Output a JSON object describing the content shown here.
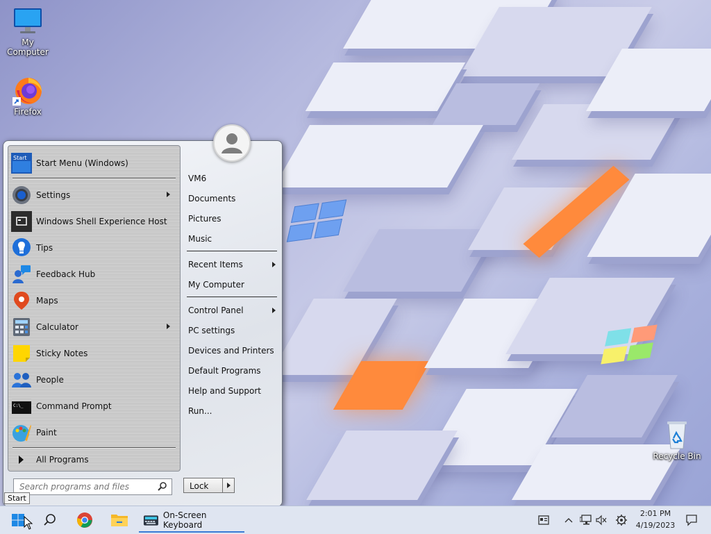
{
  "desktop": {
    "icons": [
      {
        "label": "My Computer",
        "icon": "monitor-icon"
      },
      {
        "label": "Firefox",
        "icon": "firefox-icon"
      },
      {
        "label": "Recycle Bin",
        "icon": "recycle-bin-icon"
      }
    ]
  },
  "start_menu": {
    "pinned": [
      {
        "label": "Start Menu (Windows)",
        "icon": "start-menu-icon",
        "has_submenu": false
      },
      {
        "label": "Settings",
        "icon": "gear-icon",
        "has_submenu": true
      },
      {
        "label": "Windows Shell Experience Host",
        "icon": "shell-host-icon",
        "has_submenu": false
      },
      {
        "label": "Tips",
        "icon": "lightbulb-icon",
        "has_submenu": false
      },
      {
        "label": "Feedback Hub",
        "icon": "feedback-icon",
        "has_submenu": false
      },
      {
        "label": "Maps",
        "icon": "map-pin-icon",
        "has_submenu": false
      },
      {
        "label": "Calculator",
        "icon": "calculator-icon",
        "has_submenu": true
      },
      {
        "label": "Sticky Notes",
        "icon": "sticky-note-icon",
        "has_submenu": false
      },
      {
        "label": "People",
        "icon": "people-icon",
        "has_submenu": false
      },
      {
        "label": "Command Prompt",
        "icon": "terminal-icon",
        "has_submenu": false
      },
      {
        "label": "Paint",
        "icon": "paint-icon",
        "has_submenu": false
      }
    ],
    "all_programs": "All Programs",
    "right_items": [
      {
        "label": "VM6",
        "has_submenu": false
      },
      {
        "label": "Documents",
        "has_submenu": false
      },
      {
        "label": "Pictures",
        "has_submenu": false
      },
      {
        "label": "Music",
        "has_submenu": false
      },
      {
        "label": "Recent Items",
        "has_submenu": true
      },
      {
        "label": "My Computer",
        "has_submenu": false
      },
      {
        "label": "Control Panel",
        "has_submenu": true
      },
      {
        "label": "PC settings",
        "has_submenu": false
      },
      {
        "label": "Devices and Printers",
        "has_submenu": false
      },
      {
        "label": "Default Programs",
        "has_submenu": false
      },
      {
        "label": "Help and Support",
        "has_submenu": false
      },
      {
        "label": "Run...",
        "has_submenu": false
      }
    ],
    "search_placeholder": "Search programs and files",
    "lock_label": "Lock"
  },
  "tooltip": "Start",
  "taskbar": {
    "running_app": "On-Screen Keyboard",
    "time": "2:01 PM",
    "date": "4/19/2023",
    "accent": "#3a7bd5"
  }
}
